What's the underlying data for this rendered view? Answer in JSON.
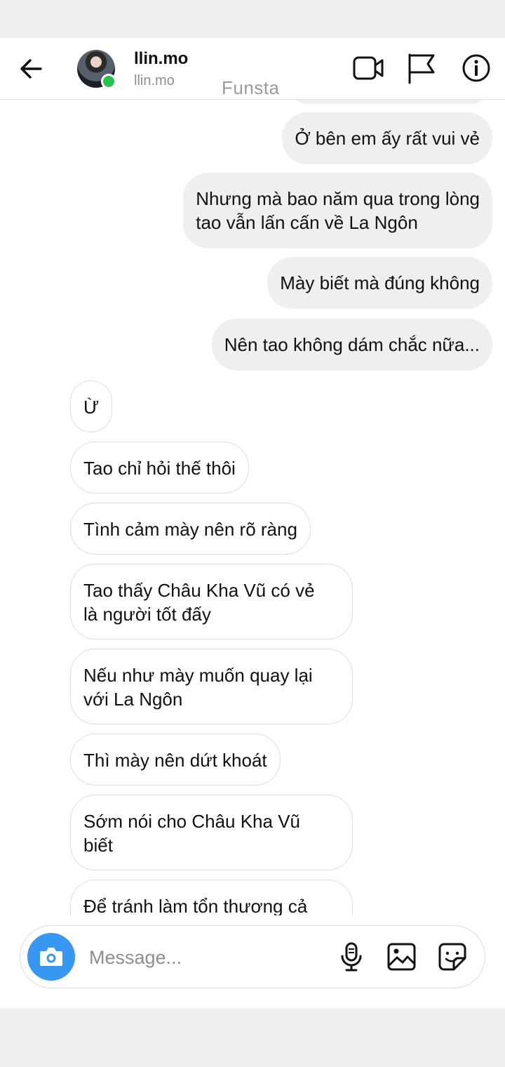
{
  "header": {
    "username": "llin.mo",
    "handle": "llin.mo",
    "watermark": "Funsta",
    "icons": [
      "back-arrow-icon",
      "video-camera-icon",
      "flag-icon",
      "info-icon"
    ],
    "online_color": "#27c24c"
  },
  "messages": [
    {
      "side": "sent",
      "text": "Ở bên em ấy rất vui vẻ"
    },
    {
      "side": "sent",
      "text": "Nhưng mà bao năm qua trong lòng\ntao vẫn lấn cấn về La Ngôn"
    },
    {
      "side": "sent",
      "text": "Mày biết mà đúng không"
    },
    {
      "side": "sent",
      "text": "Nên tao không dám chắc nữa..."
    },
    {
      "side": "received",
      "text": "Ừ"
    },
    {
      "side": "received",
      "text": "Tao chỉ hỏi thế thôi"
    },
    {
      "side": "received",
      "text": "Tình cảm mày nên rõ ràng"
    },
    {
      "side": "received",
      "text": "Tao thấy Châu Kha Vũ có vẻ\nlà người tốt đấy"
    },
    {
      "side": "received",
      "text": "Nếu như mày muốn quay lại\nvới La Ngôn"
    },
    {
      "side": "received",
      "text": "Thì mày nên dứt khoát"
    },
    {
      "side": "received",
      "text": "Sớm nói cho Châu Kha Vũ\nbiết"
    },
    {
      "side": "received",
      "text": "Để tránh làm tổn thương cả"
    }
  ],
  "composer": {
    "placeholder": "Message...",
    "icons": [
      "camera-icon",
      "microphone-icon",
      "gallery-icon",
      "sticker-icon"
    ],
    "accent": "#3897f0"
  },
  "colors": {
    "sent_bubble": "#efefef",
    "received_border": "#dedede",
    "muted_text": "#8e8e8e"
  }
}
